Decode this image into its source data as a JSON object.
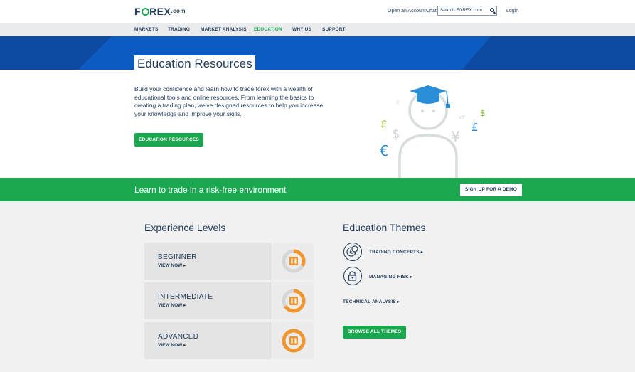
{
  "brand": {
    "name_pre": "F",
    "name_post": "REX",
    "suffix": ".com",
    "accent": "#1aa74f",
    "navy": "#1f3a5a",
    "blue": "#0c5bc0"
  },
  "top_links": {
    "open_account": "Open an Account",
    "chat": "Chat",
    "login": "Login"
  },
  "search": {
    "placeholder": "Search FOREX.com",
    "icon": "search-icon"
  },
  "nav": {
    "items": [
      "MARKETS",
      "TRADING",
      "MARKET ANALYSIS",
      "EDUCATION",
      "WHY US",
      "SUPPORT"
    ],
    "active": "EDUCATION"
  },
  "hero": {
    "title": "Education Resources",
    "body": "Build your confidence and learn how to trade forex with a wealth of educational tools and online resources. From learning the basics to creating a trading plan, we've designed resources to help you increase your knowledge and improve your skills.",
    "button": "EDUCATION RESOURCES",
    "currency_symbols": [
      "₽",
      "₣",
      "$",
      "€",
      "kr",
      "¥",
      "£",
      "$"
    ]
  },
  "strip": {
    "text": "Learn to trade in a risk-free environment",
    "button": "SIGN UP FOR A DEMO"
  },
  "experience": {
    "heading": "Experience Levels",
    "levels": [
      {
        "label": "BEGINNER",
        "link": "VIEW NOW ▸",
        "progress": 0.33
      },
      {
        "label": "INTERMEDIATE",
        "link": "VIEW NOW ▸",
        "progress": 0.66
      },
      {
        "label": "ADVANCED",
        "link": "VIEW NOW ▸",
        "progress": 1.0
      }
    ]
  },
  "themes": {
    "heading": "Education Themes",
    "items": [
      {
        "label": "TRADING CONCEPTS ▸",
        "icon": "coins-icon"
      },
      {
        "label": "MANAGING RISK ▸",
        "icon": "lock-icon"
      },
      {
        "label": "TECHNICAL ANALYSIS ▸",
        "icon": ""
      }
    ],
    "button": "BROWSE ALL THEMES"
  }
}
